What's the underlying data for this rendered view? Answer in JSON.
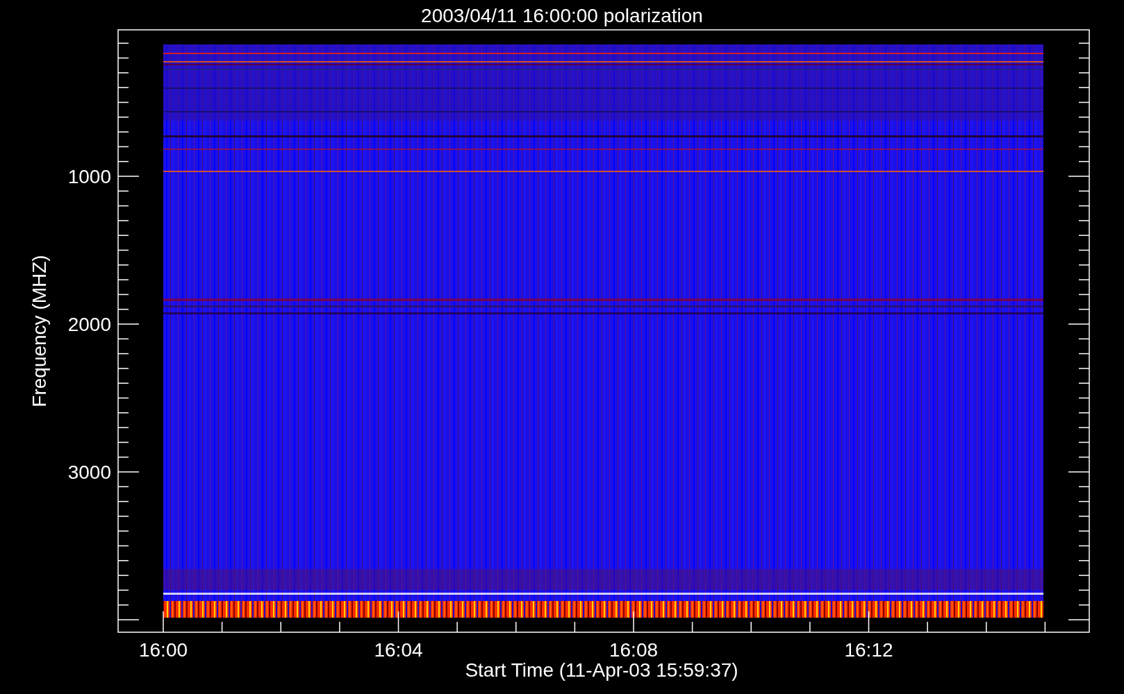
{
  "title": "2003/04/11 16:00:00 polarization",
  "plot": {
    "ylabel": "Frequency (MHZ)",
    "yticks": [
      "1000",
      "2000",
      "3000"
    ],
    "xticks": [
      "16:00",
      "16:04",
      "16:08",
      "16:12"
    ],
    "xlabel": "Start Time (11-Apr-03 15:59:37)"
  }
}
